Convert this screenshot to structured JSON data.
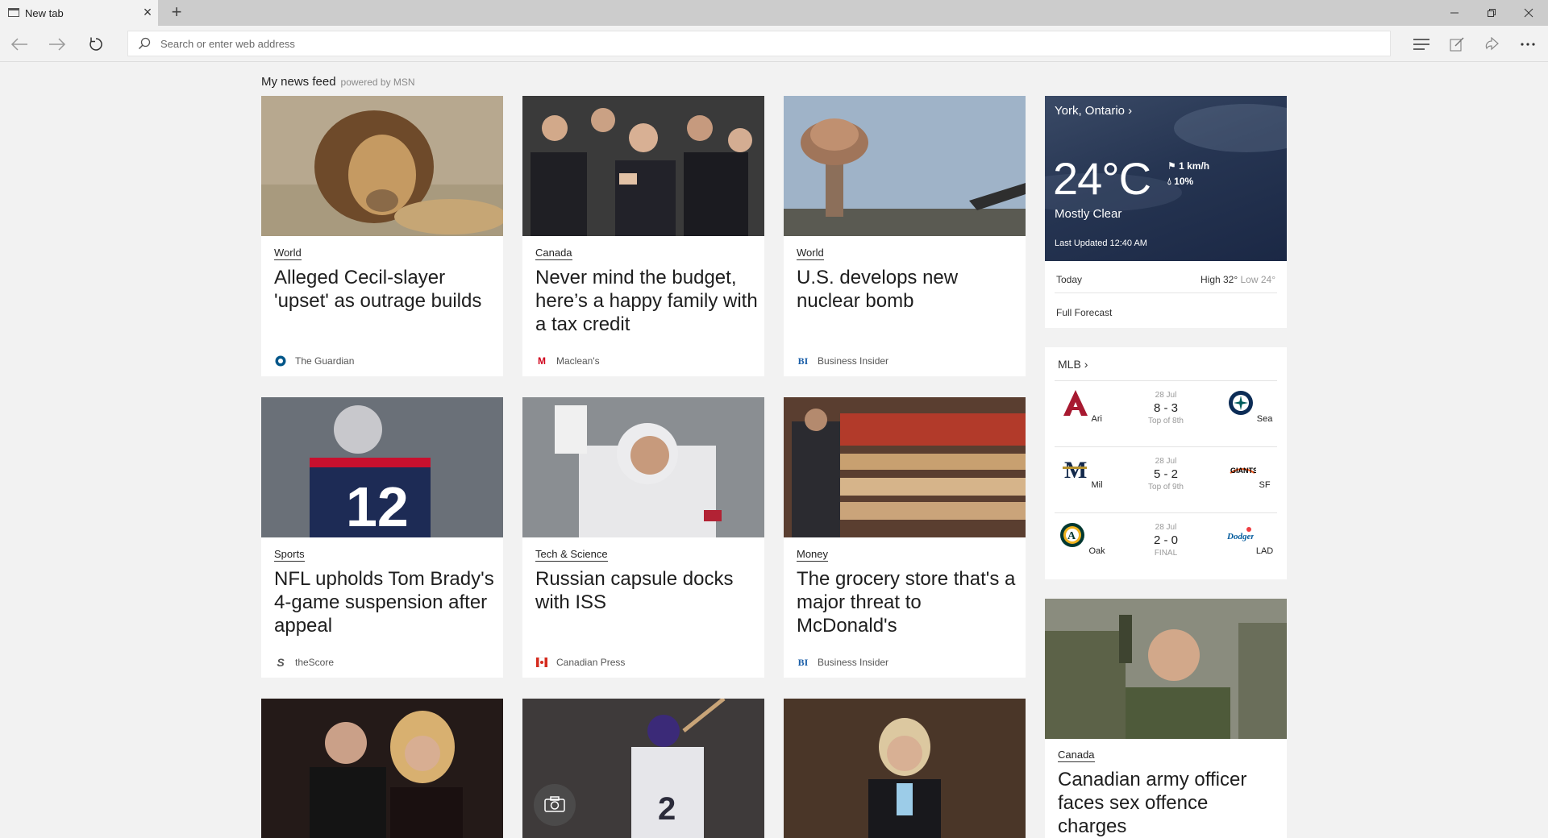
{
  "tab": {
    "title": "New tab"
  },
  "address_bar": {
    "placeholder": "Search or enter web address"
  },
  "feed": {
    "title": "My news feed",
    "powered_by": "powered by MSN"
  },
  "cards": [
    {
      "category": "World",
      "headline": "Alleged Cecil-slayer 'upset' as outrage builds",
      "source": "The Guardian",
      "image": "lion-photo"
    },
    {
      "category": "Canada",
      "headline": "Never mind the budget, here’s a happy family with a tax credit",
      "source": "Maclean's",
      "image": "politicians-applauding-photo"
    },
    {
      "category": "World",
      "headline": "U.S. develops new nuclear bomb",
      "source": "Business Insider",
      "image": "mushroom-cloud-photo"
    },
    {
      "category": "Sports",
      "headline": "NFL upholds Tom Brady's 4-game suspension after appeal",
      "source": "theScore",
      "image": "football-player-photo"
    },
    {
      "category": "Tech & Science",
      "headline": "Russian capsule docks with ISS",
      "source": "Canadian Press",
      "image": "astronaut-photo"
    },
    {
      "category": "Money",
      "headline": "The grocery store that's a major threat to McDonald's",
      "source": "Business Insider",
      "image": "grocery-store-photo"
    }
  ],
  "bottom_cards": [
    {
      "image": "couple-photo"
    },
    {
      "image": "baseball-batter-photo"
    },
    {
      "image": "politician-speaking-photo"
    }
  ],
  "weather": {
    "location": "York, Ontario",
    "temperature": "24°C",
    "wind": "1 km/h",
    "precip": "10%",
    "condition": "Mostly Clear",
    "updated": "Last Updated 12:40 AM",
    "today_label": "Today",
    "high": "High 32°",
    "low": "Low 24°",
    "full_forecast": "Full Forecast"
  },
  "mlb": {
    "title": "MLB",
    "games": [
      {
        "date": "28 Jul",
        "score": "8 - 3",
        "status": "Top of 8th",
        "away": "Ari",
        "home": "Sea"
      },
      {
        "date": "28 Jul",
        "score": "5 - 2",
        "status": "Top of 9th",
        "away": "Mil",
        "home": "SF"
      },
      {
        "date": "28 Jul",
        "score": "2 - 0",
        "status": "FINAL",
        "away": "Oak",
        "home": "LAD"
      }
    ]
  },
  "side_article": {
    "category": "Canada",
    "headline": "Canadian army officer faces sex offence charges",
    "image": "army-officer-photo"
  },
  "colors": {
    "weather_bg": "#263552",
    "page_bg": "#f2f2f2",
    "tabstrip_bg": "#cccccc"
  }
}
